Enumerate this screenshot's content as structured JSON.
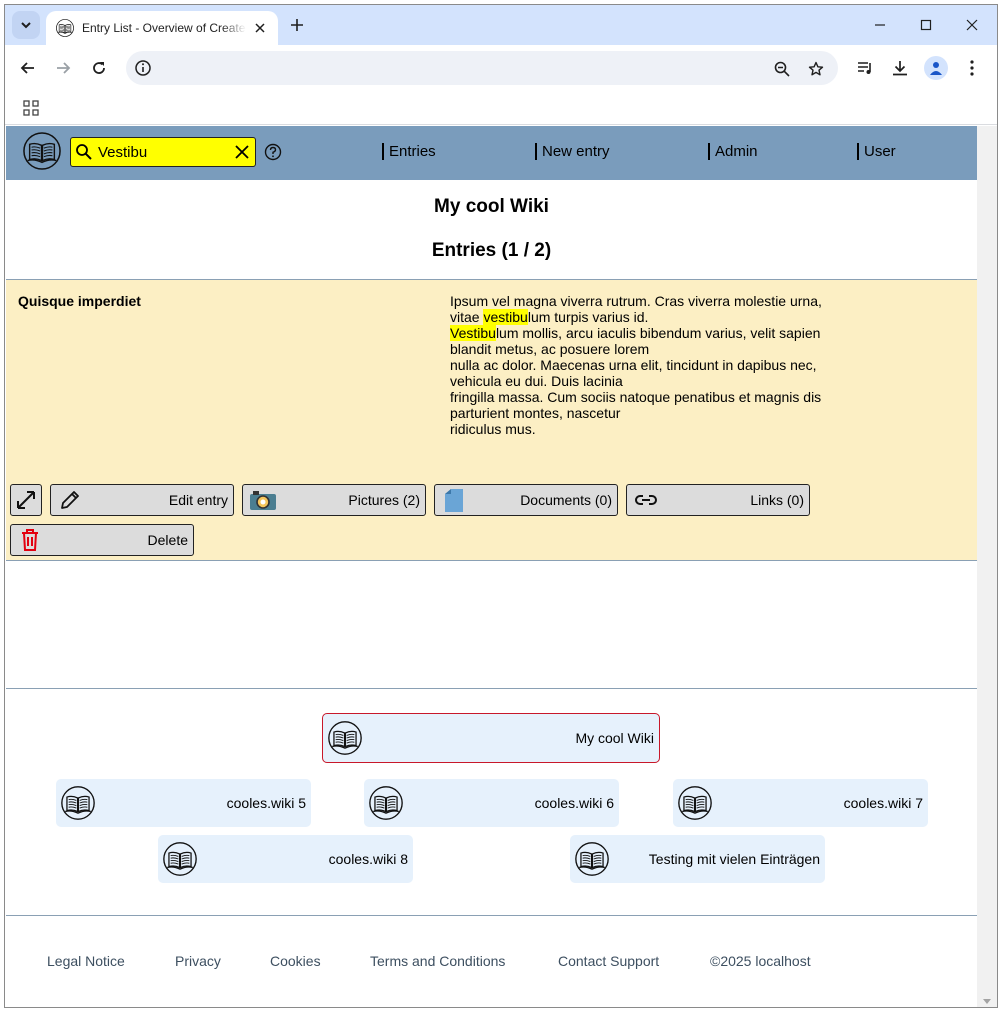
{
  "browser": {
    "tab_title": "Entry List - Overview of Created Entries",
    "url": ""
  },
  "header": {
    "search_value": "Vestibu",
    "nav": [
      "Entries",
      "New entry",
      "Admin",
      "User"
    ]
  },
  "page": {
    "wiki_title": "My cool Wiki",
    "entries_title": "Entries (1 / 2)"
  },
  "entry": {
    "title": "Quisque imperdiet",
    "lines": [
      [
        "Ipsum vel magna viverra rutrum. Cras viverra molestie urna,"
      ],
      [
        "vitae ",
        {
          "hl": "vestibu"
        },
        "lum turpis varius id."
      ],
      [
        {
          "hl": "Vestibu"
        },
        "lum mollis, arcu iaculis bibendum varius, velit sapien"
      ],
      [
        "blandit metus, ac posuere lorem"
      ],
      [
        "nulla ac dolor. Maecenas urna elit, tincidunt in dapibus nec,"
      ],
      [
        "vehicula eu dui. Duis lacinia"
      ],
      [
        "fringilla massa. Cum sociis natoque penatibus et magnis dis"
      ],
      [
        "parturient montes, nascetur"
      ],
      [
        "ridiculus mus."
      ]
    ],
    "buttons": {
      "edit": "Edit entry",
      "pictures": "Pictures (2)",
      "documents": "Documents (0)",
      "links": "Links (0)",
      "delete": "Delete"
    }
  },
  "wikis": {
    "current": "My cool Wiki",
    "others": [
      "cooles.wiki 5",
      "cooles.wiki 6",
      "cooles.wiki 7",
      "cooles.wiki 8",
      "Testing mit vielen Einträgen"
    ]
  },
  "footer": [
    "Legal Notice",
    "Privacy",
    "Cookies",
    "Terms and Conditions",
    "Contact Support",
    "©2025 localhost"
  ],
  "colors": {
    "appbar": "#7a9cbc",
    "search_highlight": "#ffff00",
    "entry_bg": "#fcefc4",
    "wiki_card_bg": "#e6f1fc",
    "current_wiki_border": "#c8182a",
    "delete_icon": "#e3000f"
  }
}
